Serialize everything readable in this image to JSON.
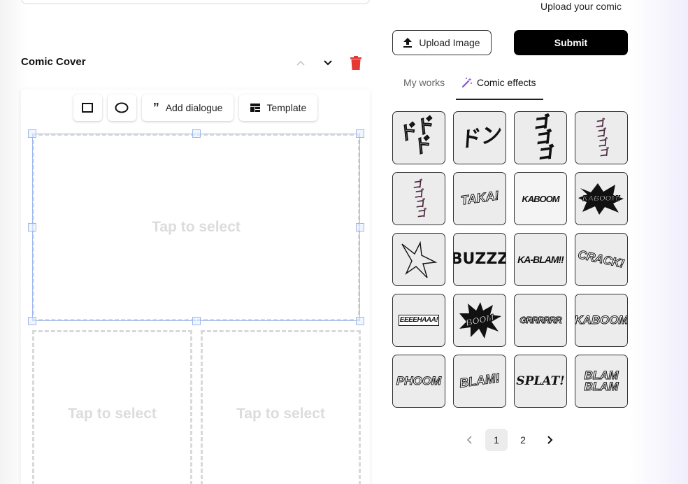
{
  "section": {
    "title": "Comic Cover"
  },
  "toolbar": {
    "add_dialogue": "Add dialogue",
    "template": "Template"
  },
  "panels": {
    "placeholder": "Tap to select"
  },
  "upload": {
    "caption": "Upload your comic",
    "button_label": "Upload Image",
    "submit_label": "Submit"
  },
  "tabs": [
    {
      "label": "My works",
      "active": false
    },
    {
      "label": "Comic effects",
      "active": true
    }
  ],
  "effects": [
    "ドドド",
    "ドン",
    "ゴゴゴ",
    "ゴゴゴゴ",
    "ゴゴゴゴ",
    "TAKA!",
    "KABOOM",
    "KABOOM!",
    "",
    "BUZZZ",
    "KA-BLAM!!",
    "CRACK!",
    "EEEEHAAA!",
    "BOOM",
    "GRRRRRR",
    "KABOOM",
    "PHOOM",
    "BLAM!",
    "SPLAT!",
    "BLAM BLAM"
  ],
  "pagination": {
    "pages": [
      "1",
      "2"
    ],
    "current": "1"
  },
  "colors": {
    "accent": "#000000",
    "delete": "#e53935",
    "selection": "#9fb8ee",
    "wand": "#8a4fd8"
  }
}
